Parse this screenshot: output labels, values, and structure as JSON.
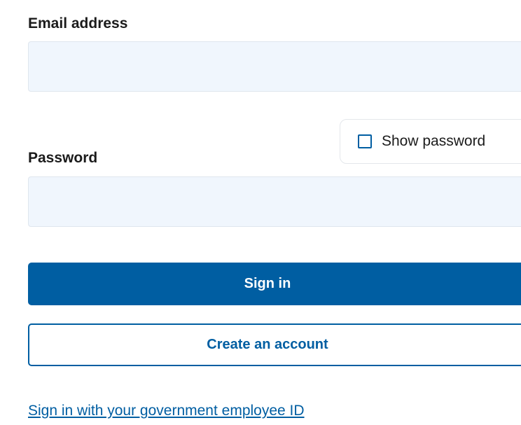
{
  "email": {
    "label": "Email address",
    "value": "",
    "placeholder": ""
  },
  "password": {
    "label": "Password",
    "value": "",
    "placeholder": "",
    "show_password_label": "Show password",
    "show_password_checked": false
  },
  "actions": {
    "sign_in_label": "Sign in",
    "create_account_label": "Create an account",
    "gov_id_link": "Sign in with your government employee ID"
  },
  "colors": {
    "primary": "#005ea2",
    "input_background": "#f0f6fd"
  }
}
